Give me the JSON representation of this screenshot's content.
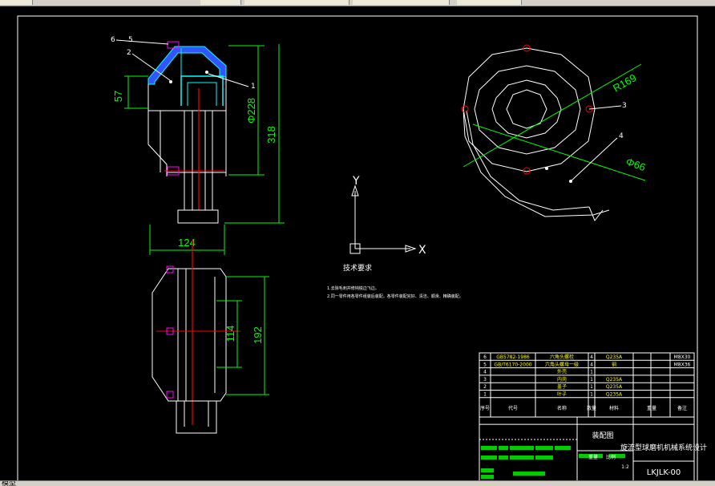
{
  "colors": {
    "background": "#000000",
    "line": "#ffffff",
    "dimension": "#00ff00",
    "centerline": "#ff0000",
    "part": "#00ffff",
    "bolt": "#ff00ff",
    "hatch": "#3355ff"
  },
  "drawing": {
    "dims": {
      "d57": "57",
      "d228": "Φ228",
      "d318": "318",
      "d124": "124",
      "d114": "114",
      "d192": "192",
      "r169": "R169",
      "d66": "Φ66"
    },
    "callouts": {
      "c6": "6",
      "c5": "5",
      "c2": "2",
      "c1": "1",
      "c3": "3",
      "c4": "4"
    },
    "axes": {
      "x": "X",
      "y": "Y"
    },
    "tech_title": "技术要求",
    "tech_notes": [
      "1.去除毛刺并修钝锐边飞边。",
      "2.同一零件用各零件组装后装配，各零件装配完好、清洁、顺滑、精确装配。"
    ]
  },
  "title_block": {
    "parts": [
      {
        "no": "6",
        "code": "GB5782-1986",
        "name": "六角头螺栓",
        "qty": "4",
        "mat": "Q235A",
        "note": "M8X30"
      },
      {
        "no": "5",
        "code": "GB/T6170-2000",
        "name": "六角头螺母一级",
        "qty": "4",
        "mat": "钢",
        "note": "M8X36"
      },
      {
        "no": "4",
        "code": "",
        "name": "外壳",
        "qty": "1",
        "mat": "",
        "note": ""
      },
      {
        "no": "3",
        "code": "",
        "name": "内壳",
        "qty": "1",
        "mat": "Q235A",
        "note": ""
      },
      {
        "no": "2",
        "code": "",
        "name": "盖子",
        "qty": "1",
        "mat": "Q235A",
        "note": ""
      },
      {
        "no": "1",
        "code": "",
        "name": "叶子",
        "qty": "1",
        "mat": "Q235A",
        "note": ""
      }
    ],
    "headers": {
      "no": "序号",
      "code": "代号",
      "name": "名称",
      "qty": "数量",
      "mat": "材料",
      "weight": "重量",
      "note": "备注"
    },
    "assembly_label": "装配图",
    "project_title": "旋流型球磨机机械系统设计",
    "drawing_no": "LKJLK-00",
    "scale_label": "比例",
    "weight_label": "重量",
    "scale_value": "1:2"
  },
  "status": {
    "text": "模型"
  }
}
